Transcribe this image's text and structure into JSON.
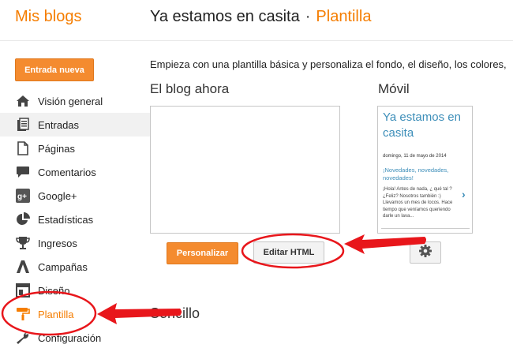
{
  "header": {
    "brand": "Mis blogs",
    "blog_name": "Ya estamos en casita",
    "separator": "·",
    "section": "Plantilla"
  },
  "sidebar": {
    "new_post_label": "Entrada nueva",
    "items": [
      {
        "label": "Visión general",
        "icon": "home-icon"
      },
      {
        "label": "Entradas",
        "icon": "posts-icon"
      },
      {
        "label": "Páginas",
        "icon": "pages-icon"
      },
      {
        "label": "Comentarios",
        "icon": "comments-icon"
      },
      {
        "label": "Google+",
        "icon": "google-plus-icon"
      },
      {
        "label": "Estadísticas",
        "icon": "pie-chart-icon"
      },
      {
        "label": "Ingresos",
        "icon": "trophy-icon"
      },
      {
        "label": "Campañas",
        "icon": "adwords-icon"
      },
      {
        "label": "Diseño",
        "icon": "layout-icon"
      },
      {
        "label": "Plantilla",
        "icon": "paint-roller-icon"
      },
      {
        "label": "Configuración",
        "icon": "wrench-icon"
      }
    ],
    "selected": "Plantilla"
  },
  "main": {
    "intro": "Empieza con una plantilla básica y personaliza el fondo, el diseño, los colores,",
    "blog_now_title": "El blog ahora",
    "mobile_title": "Móvil",
    "mobile_preview": {
      "title": "Ya estamos en casita",
      "date": "domingo, 11 de mayo de 2014",
      "post_title": "¡Novedades, novedades, novedades!",
      "post_text": "¡Hola! Antes de nada, ¿ qué tal ? ¿Feliz? Nosotros también :) Llevamos un mes de locos. Hace tiempo que veníamos queriendo darle un lava..."
    },
    "customize_label": "Personalizar",
    "edit_html_label": "Editar HTML",
    "simple_title": "Sencillo"
  },
  "colors": {
    "accent": "#f57d00",
    "button_orange": "#f48b2f",
    "annotation_red": "#e8161b",
    "mobile_link": "#3d8eb9"
  }
}
